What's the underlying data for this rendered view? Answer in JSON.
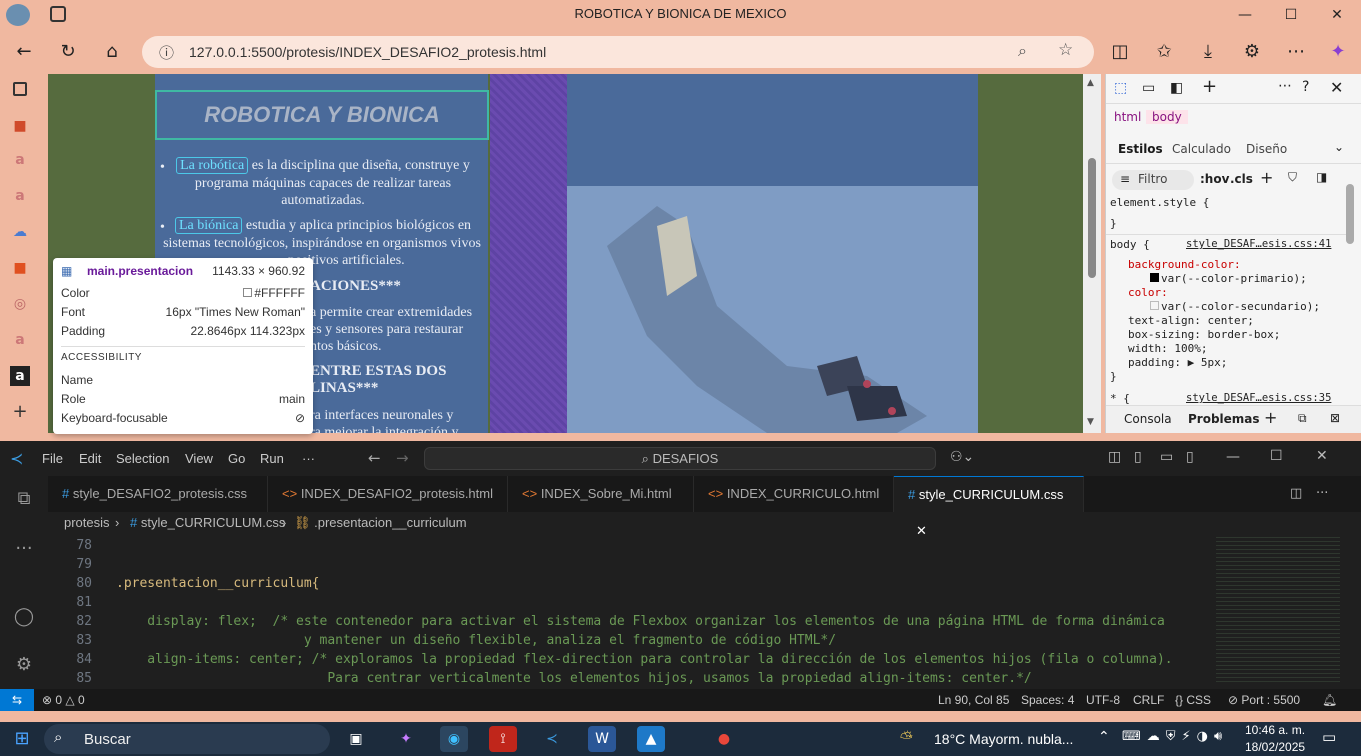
{
  "browser": {
    "title": "ROBOTICA Y BIONICA DE MEXICO",
    "url": "127.0.0.1:5500/protesis/INDEX_DESAFIO2_protesis.html"
  },
  "page": {
    "hero_title": "ROBOTICA Y BIONICA",
    "item1_link": "La robótica",
    "item1_text1": "es la disciplina que diseña, construye y",
    "item1_text2": "programa máquinas capaces de realizar tareas",
    "item1_text3": "automatizadas.",
    "item2_link": "La biónica",
    "item2_text1": "estudia y aplica principios biológicos en",
    "item2_text2": "sistemas tecnológicos, inspirándose en organismos vivos",
    "item2_text3": "positivos artificiales.",
    "heading1": "ACIONES***",
    "para1_a": "a permite crear extremidades",
    "para1_b": "es y sensores para restaurar",
    "para1_c": "ntos básicos.",
    "heading2a": "ENTRE ESTAS DOS",
    "heading2b": "LINAS***",
    "para2_a": "ra interfaces neuronales y",
    "para2_b": "ra mejorar la integración y"
  },
  "tooltip": {
    "selector": "main.presentacion",
    "size": "1143.33 × 960.92",
    "color_label": "Color",
    "color_value": "#FFFFFF",
    "font_label": "Font",
    "font_value": "16px \"Times New Roman\"",
    "padding_label": "Padding",
    "padding_value": "22.8646px 114.323px",
    "accessibility": "ACCESSIBILITY",
    "name_label": "Name",
    "role_label": "Role",
    "role_value": "main",
    "kf_label": "Keyboard-focusable"
  },
  "devtools": {
    "crumb_html": "html",
    "crumb_body": "body",
    "tab_styles": "Estilos",
    "tab_computed": "Calculado",
    "tab_layout": "Diseño",
    "filter": "Filtro",
    "hov": ":hov",
    "cls": ".cls",
    "el_style": "element.style {",
    "close_brace": "}",
    "body_sel": "body {",
    "body_src": "style_DESAF…esis.css:41",
    "p1": "background-color:",
    "p1v": "var(--color-primario);",
    "p2": "color:",
    "p2v": "var(--color-secundario);",
    "p3": "text-align: center;",
    "p4": "box-sizing: border-box;",
    "p5": "width: 100%;",
    "p6": "padding: ▶ 5px;",
    "next_sel": "* {",
    "next_src": "style_DESAF…esis.css:35",
    "console": "Consola",
    "problems": "Problemas"
  },
  "vscode": {
    "menu": [
      "File",
      "Edit",
      "Selection",
      "View",
      "Go",
      "Run",
      "···"
    ],
    "search": "DESAFIOS",
    "tabs": [
      "style_DESAFIO2_protesis.css",
      "INDEX_DESAFIO2_protesis.html",
      "INDEX_Sobre_Mi.html",
      "INDEX_CURRICULO.html",
      "style_CURRICULUM.css"
    ],
    "breadcrumb": [
      "protesis",
      "style_CURRICULUM.css",
      ".presentacion__curriculum"
    ],
    "lines": [
      {
        "n": "78",
        "t": ""
      },
      {
        "n": "79",
        "t": ""
      },
      {
        "n": "80",
        "t": ".presentacion__curriculum{"
      },
      {
        "n": "81",
        "t": ""
      },
      {
        "n": "82",
        "t": "    display: flex;  /* este contenedor para activar el sistema de Flexbox organizar los elementos de una página HTML de forma dinámica"
      },
      {
        "n": "83",
        "t": "                        y mantener un diseño flexible, analiza el fragmento de código HTML*/"
      },
      {
        "n": "84",
        "t": "    align-items: center; /* exploramos la propiedad flex-direction para controlar la dirección de los elementos hijos (fila o columna)."
      },
      {
        "n": "85",
        "t": "                           Para centrar verticalmente los elementos hijos, usamos la propiedad align-items: center.*/"
      }
    ],
    "status": {
      "errors": "0",
      "warnings": "0",
      "pos": "Ln 90, Col 85",
      "spaces": "Spaces: 4",
      "enc": "UTF-8",
      "eol": "CRLF",
      "lang": "{} CSS",
      "port": "Port : 5500"
    }
  },
  "taskbar": {
    "search": "Buscar",
    "weather": "18°C  Mayorm. nubla...",
    "time": "10:46 a. m.",
    "date": "18/02/2025"
  },
  "colors": {
    "accent": "#f0b8a0",
    "vscode_bg": "#1f1f1f",
    "page_green": "#566b3e",
    "page_blue": "#4a6a9a"
  }
}
